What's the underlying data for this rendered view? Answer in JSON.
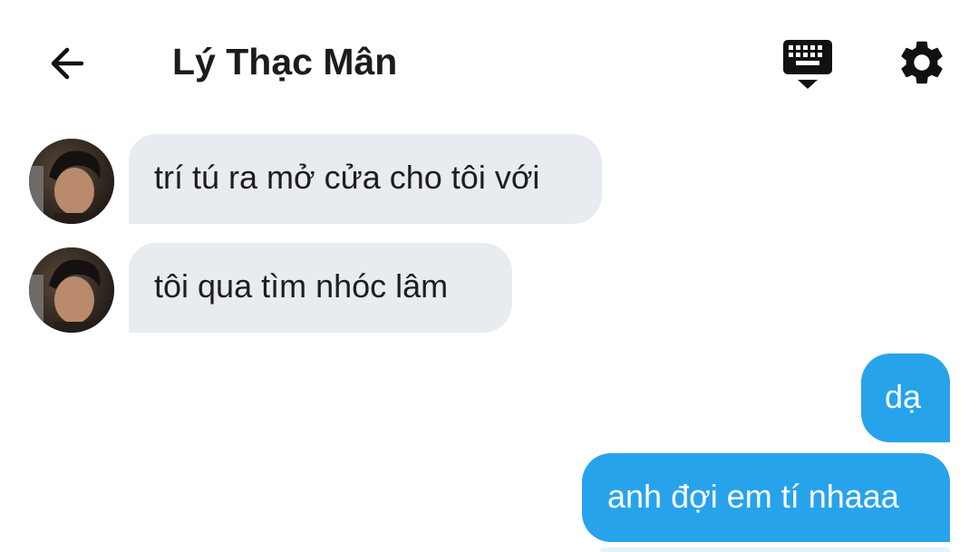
{
  "header": {
    "title": "Lý Thạc Mân",
    "back_icon": "arrow-left-icon",
    "keyboard_icon": "keyboard-hide-icon",
    "settings_icon": "gear-icon"
  },
  "colors": {
    "incoming_bubble": "#e8ebef",
    "outgoing_bubble": "#27a3ec",
    "text_dark": "#1c1c1c",
    "text_light": "#ffffff"
  },
  "messages": [
    {
      "direction": "incoming",
      "text": "trí tú ra mở cửa cho tôi với"
    },
    {
      "direction": "incoming",
      "text": "tôi qua tìm nhóc lâm"
    },
    {
      "direction": "outgoing",
      "text": "dạ"
    },
    {
      "direction": "outgoing",
      "text": "anh đợi em tí nhaaa"
    }
  ]
}
